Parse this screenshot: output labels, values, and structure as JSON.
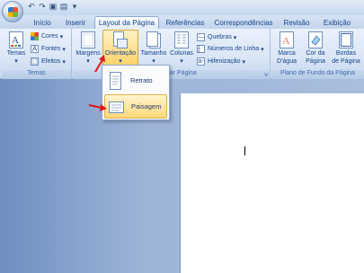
{
  "quick_access": {
    "icons": [
      "undo-icon",
      "redo-icon",
      "save-icon",
      "print-icon",
      "dropdown-icon"
    ]
  },
  "tabs": [
    {
      "label": "Início"
    },
    {
      "label": "Inserir"
    },
    {
      "label": "Layout da Página"
    },
    {
      "label": "Referências"
    },
    {
      "label": "Correspondências"
    },
    {
      "label": "Revisão"
    },
    {
      "label": "Exibição"
    }
  ],
  "ribbon": {
    "temas": {
      "button_label": "Temas",
      "cores": "Cores",
      "fontes": "Fontes",
      "efeitos": "Efeitos",
      "group_label": "Temas"
    },
    "config": {
      "margens": "Margens",
      "orientacao": "Orientação",
      "tamanho": "Tamanho",
      "colunas": "Colunas",
      "quebras": "Quebras",
      "numeros_linha": "Números de Linha",
      "hifenizacao": "Hifenização",
      "group_label": "Configurar Página"
    },
    "fundo": {
      "marca": "Marca",
      "marca2": "D'água",
      "cor": "Cor da",
      "cor2": "Página",
      "bordas": "Bordas",
      "bordas2": "de Página",
      "group_label": "Plano de Fundo da Página"
    }
  },
  "dropdown": {
    "retrato": "Retrato",
    "paisagem": "Paisagem"
  },
  "colors": {
    "accent": "#15428b",
    "arrow": "#e0161b",
    "highlight": "#ffd36b"
  }
}
